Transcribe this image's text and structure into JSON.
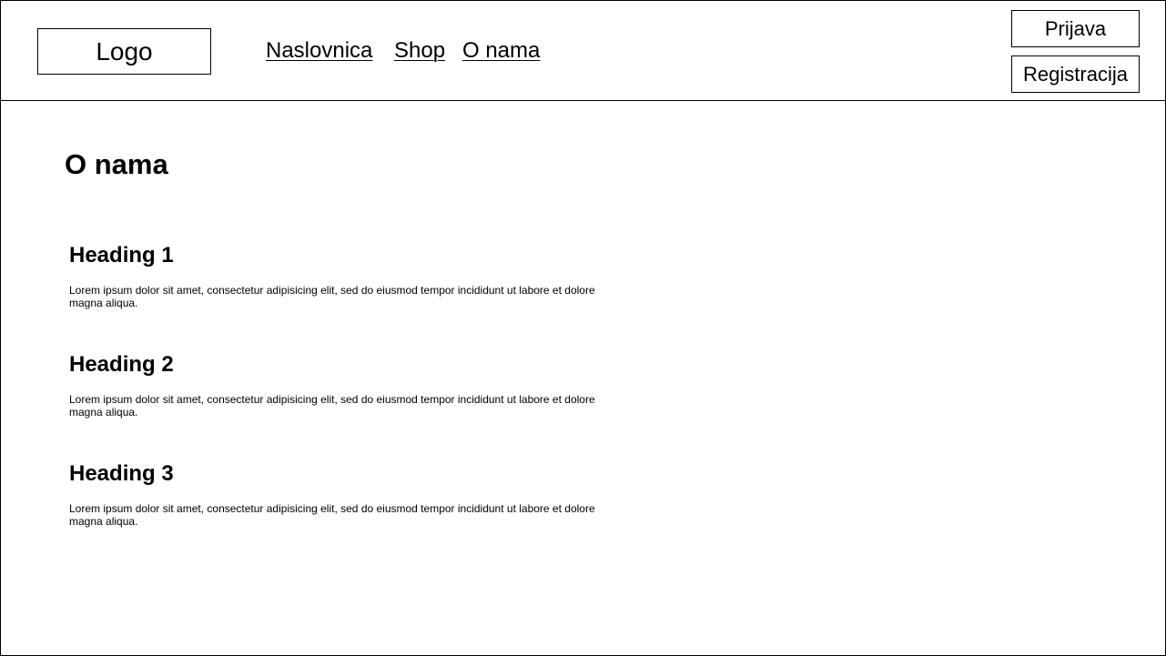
{
  "header": {
    "logo_label": "Logo",
    "nav": {
      "home": "Naslovnica",
      "shop": "Shop",
      "about": "O nama"
    },
    "auth": {
      "login": "Prijava",
      "register": "Registracija"
    }
  },
  "main": {
    "title": "O nama",
    "sections": [
      {
        "heading": "Heading 1",
        "text": "Lorem ipsum dolor sit amet, consectetur adipisicing elit, sed do eiusmod tempor incididunt ut labore et dolore magna aliqua."
      },
      {
        "heading": "Heading 2",
        "text": "Lorem ipsum dolor sit amet, consectetur adipisicing elit, sed do eiusmod tempor incididunt ut labore et dolore magna aliqua."
      },
      {
        "heading": "Heading 3",
        "text": "Lorem ipsum dolor sit amet, consectetur adipisicing elit, sed do eiusmod tempor incididunt ut labore et dolore magna aliqua."
      }
    ]
  }
}
